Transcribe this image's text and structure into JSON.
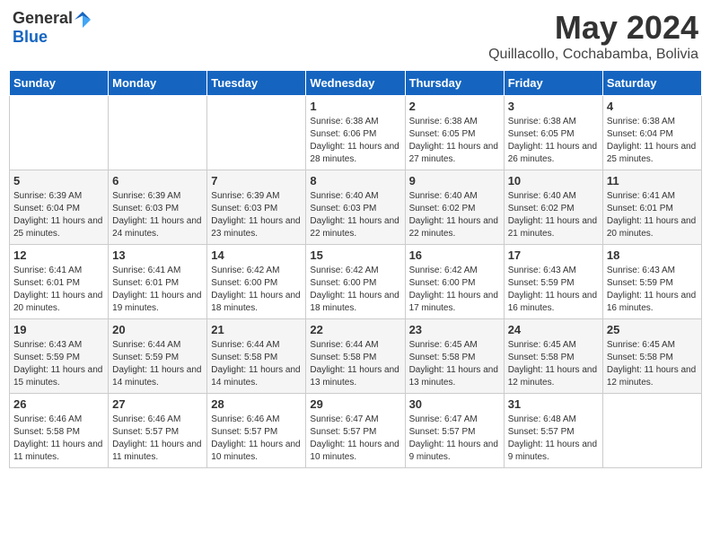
{
  "logo": {
    "general": "General",
    "blue": "Blue"
  },
  "title": "May 2024",
  "location": "Quillacollo, Cochabamba, Bolivia",
  "weekdays": [
    "Sunday",
    "Monday",
    "Tuesday",
    "Wednesday",
    "Thursday",
    "Friday",
    "Saturday"
  ],
  "weeks": [
    [
      {
        "day": "",
        "sunrise": "",
        "sunset": "",
        "daylight": ""
      },
      {
        "day": "",
        "sunrise": "",
        "sunset": "",
        "daylight": ""
      },
      {
        "day": "",
        "sunrise": "",
        "sunset": "",
        "daylight": ""
      },
      {
        "day": "1",
        "sunrise": "Sunrise: 6:38 AM",
        "sunset": "Sunset: 6:06 PM",
        "daylight": "Daylight: 11 hours and 28 minutes."
      },
      {
        "day": "2",
        "sunrise": "Sunrise: 6:38 AM",
        "sunset": "Sunset: 6:05 PM",
        "daylight": "Daylight: 11 hours and 27 minutes."
      },
      {
        "day": "3",
        "sunrise": "Sunrise: 6:38 AM",
        "sunset": "Sunset: 6:05 PM",
        "daylight": "Daylight: 11 hours and 26 minutes."
      },
      {
        "day": "4",
        "sunrise": "Sunrise: 6:38 AM",
        "sunset": "Sunset: 6:04 PM",
        "daylight": "Daylight: 11 hours and 25 minutes."
      }
    ],
    [
      {
        "day": "5",
        "sunrise": "Sunrise: 6:39 AM",
        "sunset": "Sunset: 6:04 PM",
        "daylight": "Daylight: 11 hours and 25 minutes."
      },
      {
        "day": "6",
        "sunrise": "Sunrise: 6:39 AM",
        "sunset": "Sunset: 6:03 PM",
        "daylight": "Daylight: 11 hours and 24 minutes."
      },
      {
        "day": "7",
        "sunrise": "Sunrise: 6:39 AM",
        "sunset": "Sunset: 6:03 PM",
        "daylight": "Daylight: 11 hours and 23 minutes."
      },
      {
        "day": "8",
        "sunrise": "Sunrise: 6:40 AM",
        "sunset": "Sunset: 6:03 PM",
        "daylight": "Daylight: 11 hours and 22 minutes."
      },
      {
        "day": "9",
        "sunrise": "Sunrise: 6:40 AM",
        "sunset": "Sunset: 6:02 PM",
        "daylight": "Daylight: 11 hours and 22 minutes."
      },
      {
        "day": "10",
        "sunrise": "Sunrise: 6:40 AM",
        "sunset": "Sunset: 6:02 PM",
        "daylight": "Daylight: 11 hours and 21 minutes."
      },
      {
        "day": "11",
        "sunrise": "Sunrise: 6:41 AM",
        "sunset": "Sunset: 6:01 PM",
        "daylight": "Daylight: 11 hours and 20 minutes."
      }
    ],
    [
      {
        "day": "12",
        "sunrise": "Sunrise: 6:41 AM",
        "sunset": "Sunset: 6:01 PM",
        "daylight": "Daylight: 11 hours and 20 minutes."
      },
      {
        "day": "13",
        "sunrise": "Sunrise: 6:41 AM",
        "sunset": "Sunset: 6:01 PM",
        "daylight": "Daylight: 11 hours and 19 minutes."
      },
      {
        "day": "14",
        "sunrise": "Sunrise: 6:42 AM",
        "sunset": "Sunset: 6:00 PM",
        "daylight": "Daylight: 11 hours and 18 minutes."
      },
      {
        "day": "15",
        "sunrise": "Sunrise: 6:42 AM",
        "sunset": "Sunset: 6:00 PM",
        "daylight": "Daylight: 11 hours and 18 minutes."
      },
      {
        "day": "16",
        "sunrise": "Sunrise: 6:42 AM",
        "sunset": "Sunset: 6:00 PM",
        "daylight": "Daylight: 11 hours and 17 minutes."
      },
      {
        "day": "17",
        "sunrise": "Sunrise: 6:43 AM",
        "sunset": "Sunset: 5:59 PM",
        "daylight": "Daylight: 11 hours and 16 minutes."
      },
      {
        "day": "18",
        "sunrise": "Sunrise: 6:43 AM",
        "sunset": "Sunset: 5:59 PM",
        "daylight": "Daylight: 11 hours and 16 minutes."
      }
    ],
    [
      {
        "day": "19",
        "sunrise": "Sunrise: 6:43 AM",
        "sunset": "Sunset: 5:59 PM",
        "daylight": "Daylight: 11 hours and 15 minutes."
      },
      {
        "day": "20",
        "sunrise": "Sunrise: 6:44 AM",
        "sunset": "Sunset: 5:59 PM",
        "daylight": "Daylight: 11 hours and 14 minutes."
      },
      {
        "day": "21",
        "sunrise": "Sunrise: 6:44 AM",
        "sunset": "Sunset: 5:58 PM",
        "daylight": "Daylight: 11 hours and 14 minutes."
      },
      {
        "day": "22",
        "sunrise": "Sunrise: 6:44 AM",
        "sunset": "Sunset: 5:58 PM",
        "daylight": "Daylight: 11 hours and 13 minutes."
      },
      {
        "day": "23",
        "sunrise": "Sunrise: 6:45 AM",
        "sunset": "Sunset: 5:58 PM",
        "daylight": "Daylight: 11 hours and 13 minutes."
      },
      {
        "day": "24",
        "sunrise": "Sunrise: 6:45 AM",
        "sunset": "Sunset: 5:58 PM",
        "daylight": "Daylight: 11 hours and 12 minutes."
      },
      {
        "day": "25",
        "sunrise": "Sunrise: 6:45 AM",
        "sunset": "Sunset: 5:58 PM",
        "daylight": "Daylight: 11 hours and 12 minutes."
      }
    ],
    [
      {
        "day": "26",
        "sunrise": "Sunrise: 6:46 AM",
        "sunset": "Sunset: 5:58 PM",
        "daylight": "Daylight: 11 hours and 11 minutes."
      },
      {
        "day": "27",
        "sunrise": "Sunrise: 6:46 AM",
        "sunset": "Sunset: 5:57 PM",
        "daylight": "Daylight: 11 hours and 11 minutes."
      },
      {
        "day": "28",
        "sunrise": "Sunrise: 6:46 AM",
        "sunset": "Sunset: 5:57 PM",
        "daylight": "Daylight: 11 hours and 10 minutes."
      },
      {
        "day": "29",
        "sunrise": "Sunrise: 6:47 AM",
        "sunset": "Sunset: 5:57 PM",
        "daylight": "Daylight: 11 hours and 10 minutes."
      },
      {
        "day": "30",
        "sunrise": "Sunrise: 6:47 AM",
        "sunset": "Sunset: 5:57 PM",
        "daylight": "Daylight: 11 hours and 9 minutes."
      },
      {
        "day": "31",
        "sunrise": "Sunrise: 6:48 AM",
        "sunset": "Sunset: 5:57 PM",
        "daylight": "Daylight: 11 hours and 9 minutes."
      },
      {
        "day": "",
        "sunrise": "",
        "sunset": "",
        "daylight": ""
      }
    ]
  ]
}
